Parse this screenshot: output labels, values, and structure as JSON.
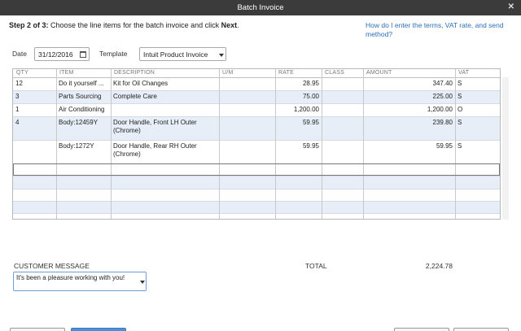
{
  "window": {
    "title": "Batch Invoice"
  },
  "step": {
    "prefix": "Step 2 of 3:",
    "text": " Choose the line items for the batch invoice and click ",
    "bold": "Next",
    "suffix": "."
  },
  "help_link": "How do I enter the terms, VAT rate, and send method?",
  "date": {
    "label": "Date",
    "value": "31/12/2016"
  },
  "template": {
    "label": "Template",
    "value": "Intuit Product Invoice"
  },
  "columns": [
    "QTY",
    "ITEM",
    "DESCRIPTION",
    "U/M",
    "RATE",
    "CLASS",
    "AMOUNT",
    "VAT"
  ],
  "rows": [
    {
      "qty": "12",
      "item": "Do it yourself ...",
      "description": "Kit for Oil Changes",
      "um": "",
      "rate": "28.95",
      "class": "",
      "amount": "347.40",
      "vat": "S"
    },
    {
      "qty": "3",
      "item": "Parts Sourcing",
      "description": "Complete Care",
      "um": "",
      "rate": "75.00",
      "class": "",
      "amount": "225.00",
      "vat": "S"
    },
    {
      "qty": "1",
      "item": "Air Conditioning",
      "description": "",
      "um": "",
      "rate": "1,200.00",
      "class": "",
      "amount": "1,200.00",
      "vat": "O"
    },
    {
      "qty": "4",
      "item": "Body:12459Y",
      "description": "Door Handle, Front LH Outer (Chrome)",
      "um": "",
      "rate": "59.95",
      "class": "",
      "amount": "239.80",
      "vat": "S"
    },
    {
      "qty": "",
      "item": "Body:1272Y",
      "description": "Door Handle, Rear RH Outer (Chrome)",
      "um": "",
      "rate": "59.95",
      "class": "",
      "amount": "59.95",
      "vat": "S"
    }
  ],
  "customer_message": {
    "label": "CUSTOMER MESSAGE",
    "value": "It's been a pleasure working with you!"
  },
  "total": {
    "label": "TOTAL",
    "value": "2,224.78"
  },
  "colors": {
    "titlebar": "#3b3b3b",
    "link": "#2a6fba",
    "row_alt": "#e7eef8",
    "primary_button": "#4a90d9"
  }
}
